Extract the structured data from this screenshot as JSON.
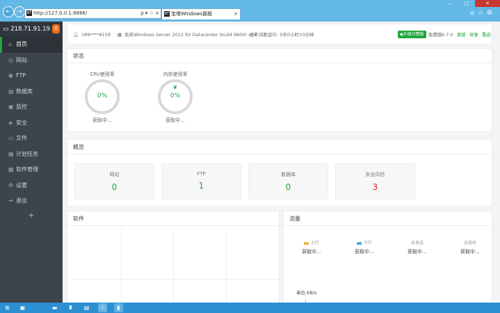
{
  "browser": {
    "url": "http://127.0.0.1:8866/",
    "tab_title": "宝塔Windows面板",
    "favicon": "BT",
    "addr_controls": "ρ ▾ ☆ ×",
    "tab_close": "×"
  },
  "sidebar": {
    "host_ip": "218.71.91.19",
    "badge": "0",
    "items": [
      {
        "label": "首页",
        "icon": "home-icon",
        "glyph": "⌂",
        "active": true
      },
      {
        "label": "网站",
        "icon": "globe-icon",
        "glyph": "◎"
      },
      {
        "label": "FTP",
        "icon": "ftp-icon",
        "glyph": "◉"
      },
      {
        "label": "数据库",
        "icon": "database-icon",
        "glyph": "▤"
      },
      {
        "label": "监控",
        "icon": "monitor-icon",
        "glyph": "▣"
      },
      {
        "label": "安全",
        "icon": "shield-icon",
        "glyph": "◈"
      },
      {
        "label": "文件",
        "icon": "file-icon",
        "glyph": "▭"
      },
      {
        "label": "计划任务",
        "icon": "calendar-icon",
        "glyph": "▦"
      },
      {
        "label": "软件管理",
        "icon": "apps-icon",
        "glyph": "▩"
      },
      {
        "label": "设置",
        "icon": "settings-icon",
        "glyph": "⚙"
      },
      {
        "label": "退出",
        "icon": "logout-icon",
        "glyph": "⇥"
      }
    ],
    "add": "+"
  },
  "infobar": {
    "user": "189****8158",
    "system_label": "系统:",
    "system": "Windows Server 2012 R2 Datacenter (build 9600) x64",
    "uptime": "已不间断运行: 0天0小时10分钟",
    "upgrade": "升级付费版",
    "edition": "免费版",
    "version": "6.7.0",
    "update": "更新",
    "repair": "修复",
    "restart": "重启"
  },
  "status": {
    "title": "状态",
    "cpu": {
      "label": "CPU使用率",
      "value": "0%",
      "sub": "获取中..."
    },
    "mem": {
      "label": "内存使用率",
      "value": "0%",
      "sub": "获取中..."
    }
  },
  "overview": {
    "title": "概览",
    "cards": [
      {
        "label": "网站",
        "value": "0",
        "color": "#20a53a"
      },
      {
        "label": "FTP",
        "value": "1",
        "color": "#20a53a"
      },
      {
        "label": "数据库",
        "value": "0",
        "color": "#20a53a"
      },
      {
        "label": "安全风险",
        "value": "3",
        "color": "#e0201e"
      }
    ]
  },
  "software": {
    "title": "软件"
  },
  "traffic": {
    "title": "流量",
    "cols": [
      {
        "label": "上行",
        "value": "获取中...",
        "color": "#f0b848"
      },
      {
        "label": "下行",
        "value": "获取中...",
        "color": "#52a9e2"
      },
      {
        "label": "总发送",
        "value": "获取中..."
      },
      {
        "label": "总接收",
        "value": "获取中..."
      }
    ],
    "unit": "单位:KB/s"
  },
  "taskbar": {
    "items": [
      "start-icon",
      "explorer-icon",
      "folder-icon",
      "server-manager-icon",
      "tools-icon",
      "ie-icon",
      "terminal-icon"
    ]
  }
}
